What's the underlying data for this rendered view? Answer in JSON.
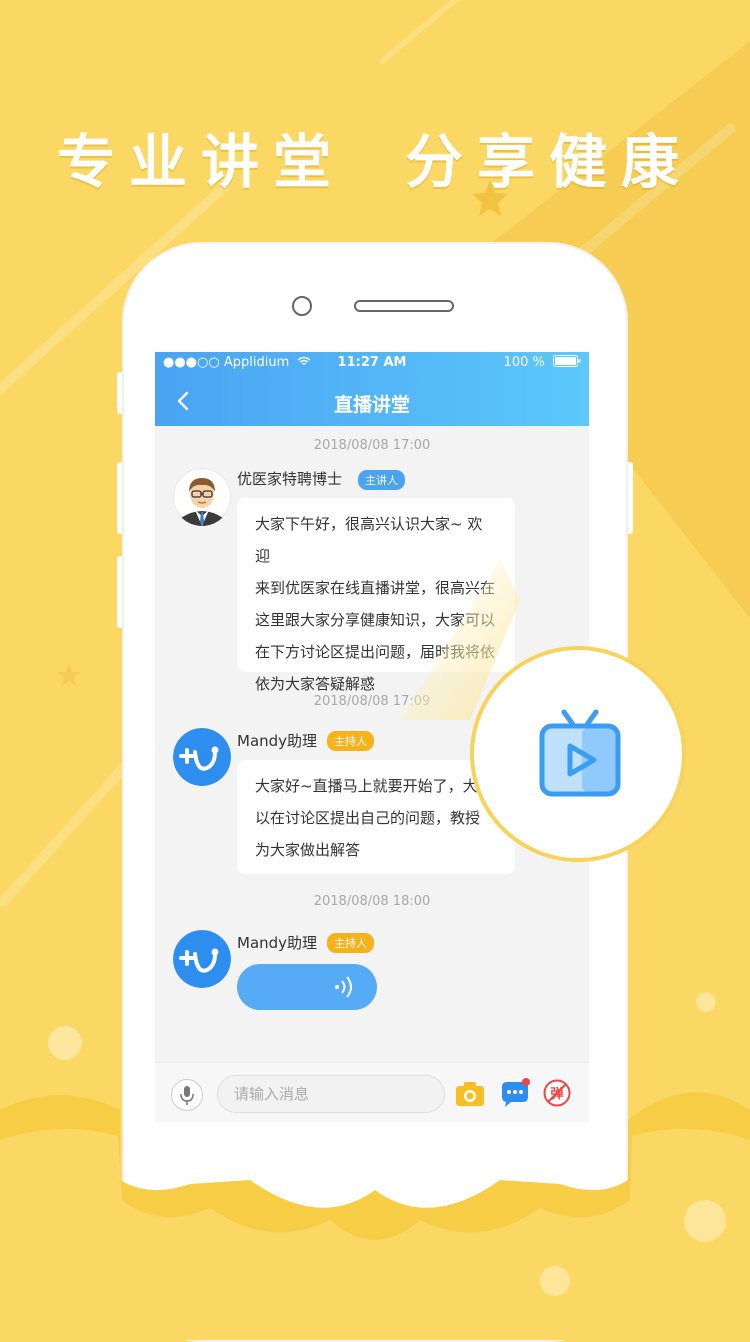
{
  "headline": {
    "left": "专业讲堂",
    "right": "分享健康"
  },
  "status_bar": {
    "carrier": "Applidium",
    "time": "11:27 AM",
    "battery": "100 %"
  },
  "nav": {
    "title": "直播讲堂"
  },
  "messages": [
    {
      "timestamp": "2018/08/08 17:00",
      "sender": "优医家特聘博士",
      "badge": "主讲人",
      "badge_color": "#4aa3f3",
      "lines": [
        "大家下午好，很高兴认识大家~ 欢迎",
        "来到优医家在线直播讲堂，很高兴在",
        "这里跟大家分享健康知识，大家可以",
        "在下方讨论区提出问题，届时我将依",
        "依为大家答疑解惑"
      ]
    },
    {
      "timestamp": "2018/08/08 17:09",
      "sender": "Mandy助理",
      "badge": "主持人",
      "badge_color": "#f5b21b",
      "lines": [
        "大家好~直播马上就要开始了，大",
        "以在讨论区提出自己的问题，教授",
        "为大家做出解答"
      ]
    },
    {
      "timestamp": "2018/08/08 18:00",
      "sender": "Mandy助理",
      "badge": "主持人",
      "badge_color": "#f5b21b",
      "voice": true
    }
  ],
  "input": {
    "placeholder": "请输入消息"
  },
  "toolbar": {
    "danmaku_label": "弹"
  },
  "colors": {
    "background": "#fbd864",
    "nav_blue": "#4aa3f3",
    "accent_orange": "#f5b21b",
    "bubble_blue": "#57aaf6"
  },
  "icons": [
    "back-chevron-icon",
    "wifi-icon",
    "battery-icon",
    "microphone-icon",
    "camera-icon",
    "chat-bubble-icon",
    "danmaku-off-icon",
    "tv-live-icon",
    "voice-wave-icon"
  ]
}
